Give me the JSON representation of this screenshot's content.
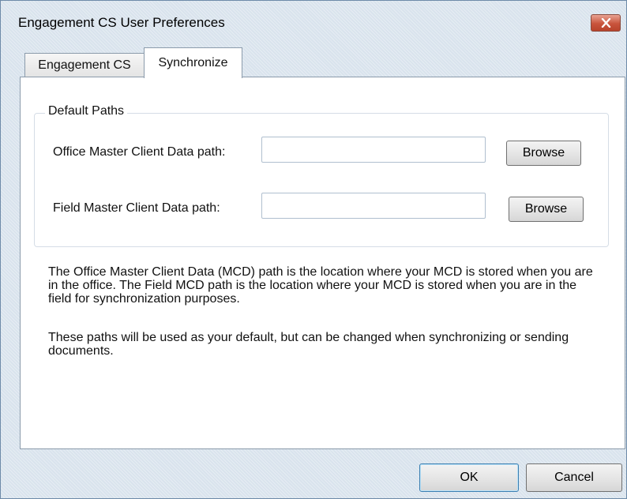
{
  "window": {
    "title": "Engagement CS User Preferences",
    "close_icon": "close-icon"
  },
  "tabs": [
    {
      "label": "Engagement CS",
      "active": false
    },
    {
      "label": "Synchronize",
      "active": true
    }
  ],
  "default_paths": {
    "group_label": "Default Paths",
    "office": {
      "label": "Office Master Client Data path:",
      "value": "",
      "browse_label": "Browse"
    },
    "field": {
      "label": "Field Master Client Data path:",
      "value": "",
      "browse_label": "Browse"
    }
  },
  "description": {
    "paragraph1": "The Office Master Client Data (MCD) path is the location where your MCD is stored when you are in the office.  The Field MCD path is the location where your MCD is stored when you are in the field for synchronization purposes.",
    "paragraph2": "These paths will be used as your default, but can be changed when synchronizing or sending documents."
  },
  "footer": {
    "ok_label": "OK",
    "cancel_label": "Cancel"
  },
  "colors": {
    "close_button": "#c9543c",
    "window_frame": "#d9e3ed",
    "default_button_border": "#3c7fb1"
  }
}
